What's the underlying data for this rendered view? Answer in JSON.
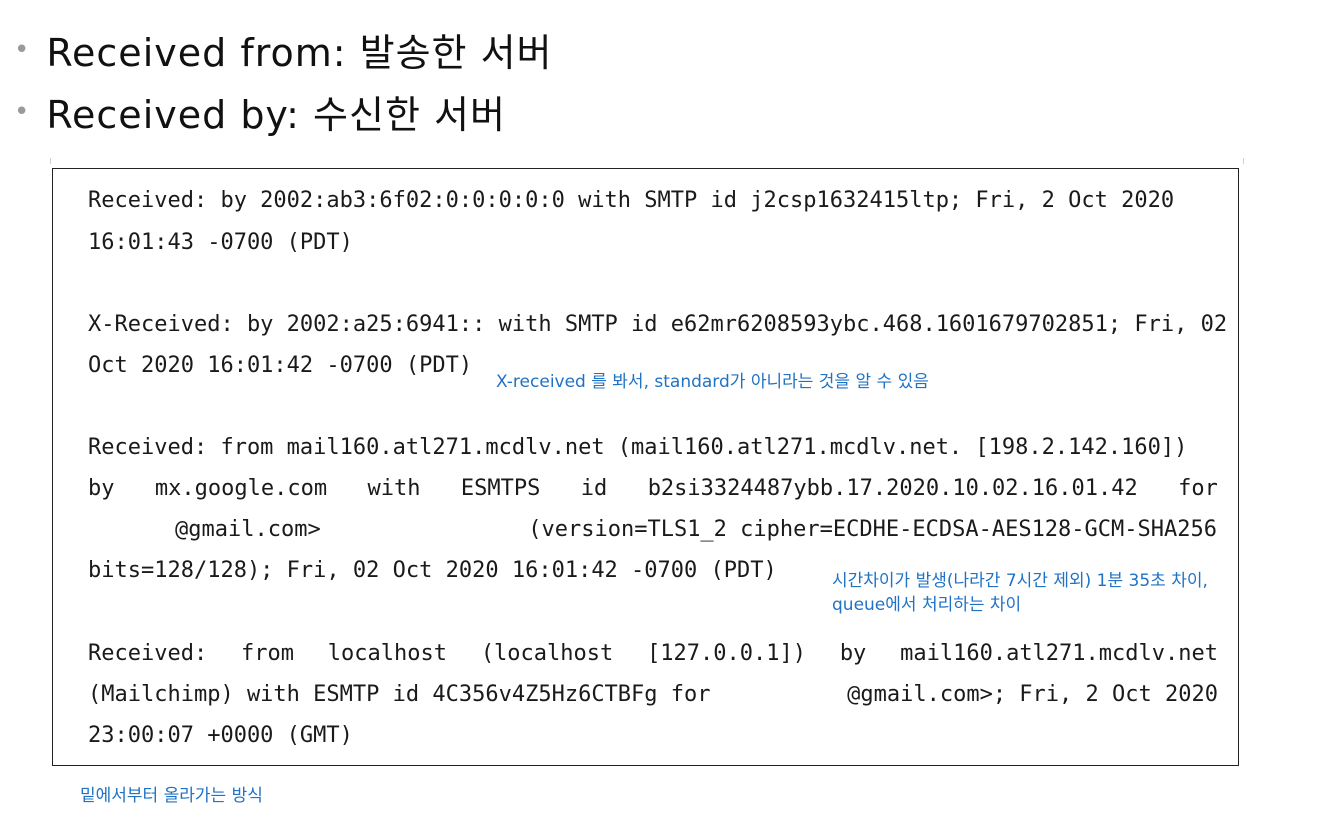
{
  "bullets": [
    {
      "text": "Received from: 발송한 서버"
    },
    {
      "text": "Received by: 수신한 서버"
    }
  ],
  "header_block": {
    "h1": {
      "line1": "Received: by 2002:ab3:6f02:0:0:0:0:0 with SMTP id j2csp1632415ltp; Fri, 2 Oct 2020",
      "line2": "16:01:43 -0700 (PDT)"
    },
    "h2": {
      "line1": "X-Received: by 2002:a25:6941:: with SMTP id e62mr6208593ybc.468.1601679702851; Fri, 02",
      "line2": "Oct 2020 16:01:42 -0700 (PDT)"
    },
    "h3": {
      "line1": "Received: from mail160.atl271.mcdlv.net (mail160.atl271.mcdlv.net. [198.2.142.160])",
      "line2_words": [
        "by",
        "mx.google.com",
        "with",
        "ESMTPS",
        "id",
        "b2si3324487ybb.17.2020.10.02.16.01.42",
        "for"
      ],
      "line3_a": "@gmail.com>",
      "line3_b": "(version=TLS1_2 cipher=ECDHE-ECDSA-AES128-GCM-SHA256",
      "line4": "bits=128/128); Fri, 02 Oct 2020 16:01:42 -0700 (PDT)"
    },
    "h4": {
      "line1_words": [
        "Received:",
        "from",
        "localhost",
        "(localhost",
        "[127.0.0.1])",
        "by",
        "mail160.atl271.mcdlv.net"
      ],
      "line2_a": "(Mailchimp) with ESMTP id 4C356v4Z5Hz6CTBFg for",
      "line2_b": "@gmail.com>; Fri, 2 Oct 2020",
      "line3": "23:00:07 +0000 (GMT)"
    }
  },
  "annotations": {
    "xreceived_note": "X-received 를 봐서, standard가 아니라는 것을 알 수 있음",
    "time_note_line1": "시간차이가 발생(나라간 7시간 제외) 1분 35초 차이,",
    "time_note_line2": "queue에서 처리하는 차이",
    "bottom_note": "밑에서부터 올라가는 방식"
  },
  "colors": {
    "annotation": "#1f72c4",
    "text": "#1a1a1a",
    "frame": "#222222"
  }
}
